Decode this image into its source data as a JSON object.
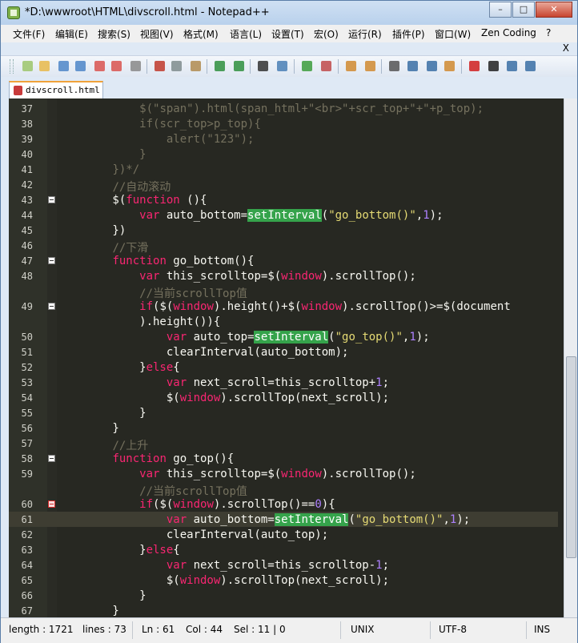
{
  "window": {
    "title": "*D:\\wwwroot\\HTML\\divscroll.html - Notepad++"
  },
  "menu": {
    "items": [
      "文件(F)",
      "编辑(E)",
      "搜索(S)",
      "视图(V)",
      "格式(M)",
      "语言(L)",
      "设置(T)",
      "宏(O)",
      "运行(R)",
      "插件(P)",
      "窗口(W)",
      "Zen Coding",
      "?"
    ],
    "close_x": "X"
  },
  "tab": {
    "label": "divscroll.html"
  },
  "editor": {
    "lines": [
      {
        "n": "37",
        "segs": [
          [
            "            ",
            ""
          ],
          [
            "$(\"span\").html(span_html+\"<br>\"+scr_top+\"+\"+p_top);",
            "k-cm"
          ]
        ]
      },
      {
        "n": "38",
        "segs": [
          [
            "            ",
            ""
          ],
          [
            "if(scr_top>p_top){",
            "k-cm"
          ]
        ]
      },
      {
        "n": "39",
        "segs": [
          [
            "                ",
            ""
          ],
          [
            "alert(\"123\");",
            "k-cm"
          ]
        ]
      },
      {
        "n": "40",
        "segs": [
          [
            "            ",
            ""
          ],
          [
            "}",
            "k-cm"
          ]
        ]
      },
      {
        "n": "41",
        "segs": [
          [
            "        ",
            ""
          ],
          [
            "})*/",
            "k-cm"
          ]
        ]
      },
      {
        "n": "42",
        "segs": [
          [
            "        ",
            ""
          ],
          [
            "//自动滚动",
            "k-cm"
          ]
        ]
      },
      {
        "n": "43",
        "fold": true,
        "segs": [
          [
            "        $(",
            ""
          ],
          [
            "function",
            "k-kw"
          ],
          [
            " (){",
            ""
          ]
        ]
      },
      {
        "n": "44",
        "segs": [
          [
            "            ",
            ""
          ],
          [
            "var",
            "k-kw"
          ],
          [
            " auto_bottom=",
            ""
          ],
          [
            "setInterval",
            "k-hl"
          ],
          [
            "(",
            ""
          ],
          [
            "\"go_bottom()\"",
            "k-str"
          ],
          [
            ",",
            ""
          ],
          [
            "1",
            "k-num"
          ],
          [
            ");",
            ""
          ]
        ]
      },
      {
        "n": "45",
        "segs": [
          [
            "        })",
            ""
          ]
        ]
      },
      {
        "n": "46",
        "segs": [
          [
            "        ",
            ""
          ],
          [
            "//下滑",
            "k-cm"
          ]
        ]
      },
      {
        "n": "47",
        "fold": true,
        "segs": [
          [
            "        ",
            ""
          ],
          [
            "function",
            "k-kw"
          ],
          [
            " go_bottom(){",
            ""
          ]
        ]
      },
      {
        "n": "48",
        "segs": [
          [
            "            ",
            ""
          ],
          [
            "var",
            "k-kw"
          ],
          [
            " this_scrolltop=$(",
            ""
          ],
          [
            "window",
            "k-win"
          ],
          [
            ").scrollTop();",
            ""
          ]
        ]
      },
      {
        "n": "",
        "segs": [
          [
            "            ",
            ""
          ],
          [
            "//当前scrollTop值",
            "k-cm"
          ]
        ]
      },
      {
        "n": "49",
        "fold": true,
        "segs": [
          [
            "            ",
            ""
          ],
          [
            "if",
            "k-kw"
          ],
          [
            "($(",
            ""
          ],
          [
            "window",
            "k-win"
          ],
          [
            ").height()+$(",
            ""
          ],
          [
            "window",
            "k-win"
          ],
          [
            ").scrollTop()>=$(document",
            ""
          ]
        ]
      },
      {
        "n": "",
        "segs": [
          [
            "            ).height()){",
            ""
          ]
        ]
      },
      {
        "n": "50",
        "segs": [
          [
            "                ",
            ""
          ],
          [
            "var",
            "k-kw"
          ],
          [
            " auto_top=",
            ""
          ],
          [
            "setInterval",
            "k-hl"
          ],
          [
            "(",
            ""
          ],
          [
            "\"go_top()\"",
            "k-str"
          ],
          [
            ",",
            ""
          ],
          [
            "1",
            "k-num"
          ],
          [
            ");",
            ""
          ]
        ]
      },
      {
        "n": "51",
        "segs": [
          [
            "                clearInterval(auto_bottom);",
            ""
          ]
        ]
      },
      {
        "n": "52",
        "segs": [
          [
            "            }",
            ""
          ],
          [
            "else",
            "k-kw"
          ],
          [
            "{",
            ""
          ]
        ]
      },
      {
        "n": "53",
        "segs": [
          [
            "                ",
            ""
          ],
          [
            "var",
            "k-kw"
          ],
          [
            " next_scroll=this_scrolltop+",
            ""
          ],
          [
            "1",
            "k-num"
          ],
          [
            ";",
            ""
          ]
        ]
      },
      {
        "n": "54",
        "segs": [
          [
            "                $(",
            ""
          ],
          [
            "window",
            "k-win"
          ],
          [
            ").scrollTop(next_scroll);",
            ""
          ]
        ]
      },
      {
        "n": "55",
        "segs": [
          [
            "            }",
            ""
          ]
        ]
      },
      {
        "n": "56",
        "segs": [
          [
            "        }",
            ""
          ]
        ]
      },
      {
        "n": "57",
        "segs": [
          [
            "        ",
            ""
          ],
          [
            "//上升",
            "k-cm"
          ]
        ]
      },
      {
        "n": "58",
        "fold": true,
        "segs": [
          [
            "        ",
            ""
          ],
          [
            "function",
            "k-kw"
          ],
          [
            " go_top(){",
            ""
          ]
        ]
      },
      {
        "n": "59",
        "segs": [
          [
            "            ",
            ""
          ],
          [
            "var",
            "k-kw"
          ],
          [
            " this_scrolltop=$(",
            ""
          ],
          [
            "window",
            "k-win"
          ],
          [
            ").scrollTop();",
            ""
          ]
        ]
      },
      {
        "n": "",
        "segs": [
          [
            "            ",
            ""
          ],
          [
            "//当前scrollTop值",
            "k-cm"
          ]
        ]
      },
      {
        "n": "60",
        "fold": true,
        "red": true,
        "segs": [
          [
            "            ",
            ""
          ],
          [
            "if",
            "k-kw"
          ],
          [
            "($(",
            ""
          ],
          [
            "window",
            "k-win"
          ],
          [
            ").scrollTop()==",
            ""
          ],
          [
            "0",
            "k-num"
          ],
          [
            "){",
            ""
          ]
        ]
      },
      {
        "n": "61",
        "caret": true,
        "segs": [
          [
            "                ",
            ""
          ],
          [
            "var",
            "k-kw"
          ],
          [
            " auto_bottom=",
            ""
          ],
          [
            "setInterval",
            "k-hl"
          ],
          [
            "(",
            ""
          ],
          [
            "\"go_bottom()\"",
            "k-str"
          ],
          [
            ",",
            ""
          ],
          [
            "1",
            "k-num"
          ],
          [
            ");",
            ""
          ]
        ]
      },
      {
        "n": "62",
        "segs": [
          [
            "                clearInterval(auto_top);",
            ""
          ]
        ]
      },
      {
        "n": "63",
        "segs": [
          [
            "            }",
            ""
          ],
          [
            "else",
            "k-kw"
          ],
          [
            "{",
            ""
          ]
        ]
      },
      {
        "n": "64",
        "segs": [
          [
            "                ",
            ""
          ],
          [
            "var",
            "k-kw"
          ],
          [
            " next_scroll=this_scrolltop-",
            ""
          ],
          [
            "1",
            "k-num"
          ],
          [
            ";",
            ""
          ]
        ]
      },
      {
        "n": "65",
        "segs": [
          [
            "                $(",
            ""
          ],
          [
            "window",
            "k-win"
          ],
          [
            ").scrollTop(next_scroll);",
            ""
          ]
        ]
      },
      {
        "n": "66",
        "segs": [
          [
            "            }",
            ""
          ]
        ]
      },
      {
        "n": "67",
        "segs": [
          [
            "        }",
            ""
          ]
        ]
      }
    ]
  },
  "status": {
    "length": "length : 1721",
    "lines": "lines : 73",
    "ln": "Ln : 61",
    "col": "Col : 44",
    "sel": "Sel : 11 | 0",
    "eol": "UNIX",
    "encoding": "UTF-8",
    "mode": "INS"
  }
}
